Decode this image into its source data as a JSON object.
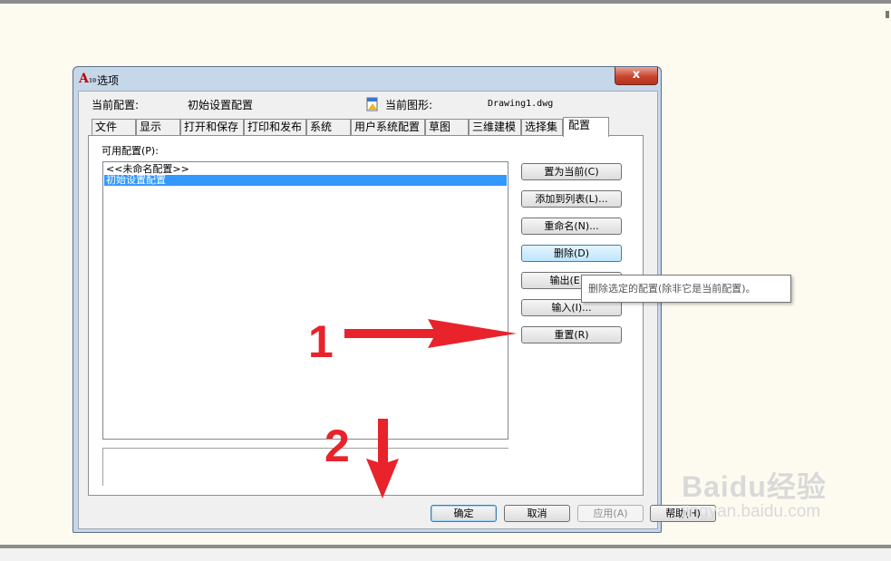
{
  "window": {
    "title": "选项",
    "close_glyph": "x"
  },
  "header": {
    "current_profile_label": "当前配置:",
    "current_profile_value": "初始设置配置",
    "current_drawing_label": "当前图形:",
    "current_drawing_value": "Drawing1.dwg"
  },
  "tabs": [
    "文件",
    "显示",
    "打开和保存",
    "打印和发布",
    "系统",
    "用户系统配置",
    "草图",
    "三维建模",
    "选择集",
    "配置"
  ],
  "active_tab": "配置",
  "profiles": {
    "label": "可用配置(P):",
    "items": [
      "<<未命名配置>>",
      "初始设置配置"
    ],
    "selected_index": 1
  },
  "side_buttons": {
    "set_current": "置为当前(C)",
    "add_to_list": "添加到列表(L)...",
    "rename": "重命名(N)...",
    "delete": "删除(D)",
    "export": "输出(E)...",
    "import": "输入(I)...",
    "reset": "重置(R)"
  },
  "tooltip": "删除选定的配置(除非它是当前配置)。",
  "footer_buttons": {
    "ok": "确定",
    "cancel": "取消",
    "apply": "应用(A)",
    "help": "帮助(H)"
  },
  "annotations": {
    "step1": "1",
    "step2": "2",
    "arrow_color": "#e8232b"
  },
  "watermark": {
    "logo": "Baidu经验",
    "url": "jingyan.baidu.com"
  },
  "colors": {
    "selection": "#3399ff",
    "dialog_frame": "#c7d7ea",
    "close_button": "#c7452f"
  }
}
